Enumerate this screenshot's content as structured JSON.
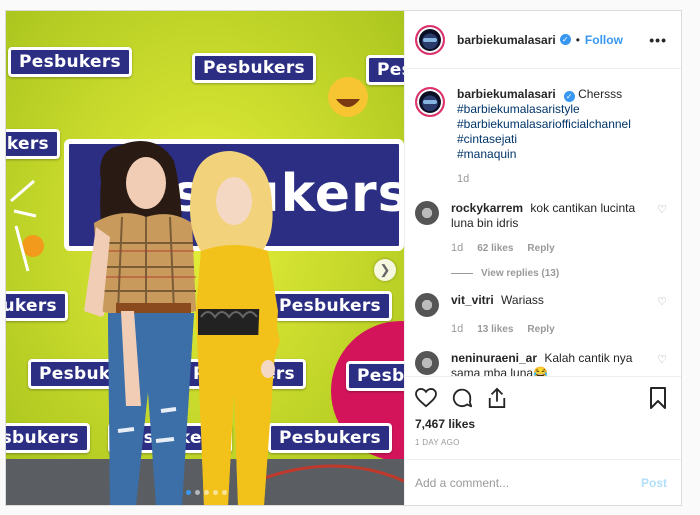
{
  "post": {
    "username": "barbiekumalasari",
    "separator": "•",
    "follow_label": "Follow",
    "more_label": "•••",
    "photo": {
      "logo_text": "Pesbukers",
      "big_logo_text": "Pesbukers"
    },
    "caption": {
      "username": "barbiekumalasari",
      "text": "Chersss",
      "hashtags": [
        "#barbiekumalasaristyle",
        "#barbiekumalasariofficialchannel",
        "#cintasejati",
        "#manaquin"
      ],
      "time": "1d"
    },
    "comments": [
      {
        "username": "rockykarrem",
        "text": "kok cantikan lucinta luna bin idris",
        "time": "1d",
        "likes": "62 likes",
        "reply_label": "Reply",
        "view_replies": "View replies (13)"
      },
      {
        "username": "vit_vitri",
        "text": "Wariass",
        "time": "1d",
        "likes": "13 likes",
        "reply_label": "Reply"
      },
      {
        "username": "neninuraeni_ar",
        "text": "Kalah cantik nya sama mba luna😂"
      }
    ],
    "likes_count": "7,467 likes",
    "posted_ago": "1 DAY AGO",
    "comment_placeholder": "Add a comment...",
    "post_label": "Post"
  },
  "colors": {
    "link_blue": "#3897f0",
    "hashtag": "#003569",
    "backdrop_green": "#cfdc2a",
    "logo_navy": "#2b2e83"
  }
}
